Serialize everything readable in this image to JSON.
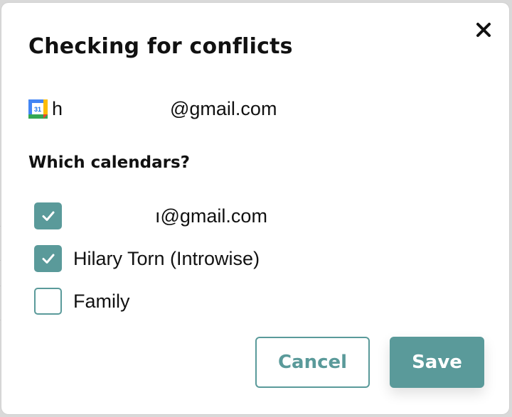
{
  "dialog": {
    "title": "Checking for conflicts",
    "close_icon": "close-icon",
    "account": {
      "icon": "google-calendar-icon",
      "icon_number": "31",
      "visible_prefix": "h",
      "email_suffix": "@gmail.com"
    },
    "calendars_heading": "Which calendars?",
    "calendars": [
      {
        "label": "ı@gmail.com",
        "checked": true
      },
      {
        "label": "Hilary Torn (Introwise)",
        "checked": true
      },
      {
        "label": "Family",
        "checked": false
      }
    ],
    "cancel_label": "Cancel",
    "save_label": "Save"
  },
  "colors": {
    "accent": "#5a9a9a",
    "text": "#111111",
    "background": "#ffffff",
    "overlay": "#d9d9d9"
  }
}
